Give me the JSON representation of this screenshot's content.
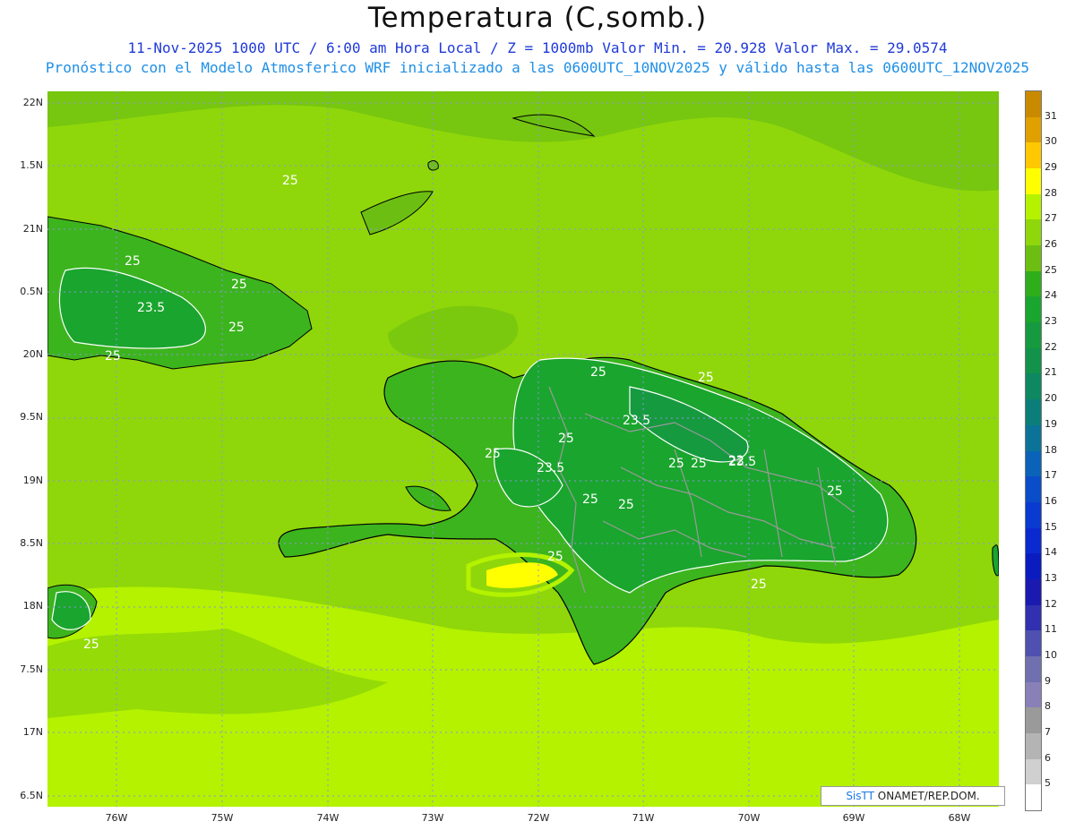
{
  "title": "Temperatura (C,somb.)",
  "subtitle_line1": "11-Nov-2025  1000 UTC / 6:00 am Hora Local / Z = 1000mb    Valor Min. = 20.928  Valor Max. = 29.0574",
  "subtitle_line2": "Pronóstico con el Modelo Atmosferico WRF inicializado a las 0600UTC_10NOV2025 y válido hasta las  0600UTC_12NOV2025",
  "colors": {
    "title": "#111111",
    "subtitle1": "#1f3ad8",
    "subtitle2": "#1f8fe6",
    "ocean_main": "#8fd70a",
    "ocean_light": "#b4f200",
    "land_dark": "#1aa52e",
    "land_mid": "#3cb41e",
    "contour": "#ffffff",
    "border": "#9a9a9a",
    "coast": "#000000"
  },
  "y_axis": {
    "labels": [
      "22N",
      "1.5N",
      "21N",
      "0.5N",
      "20N",
      "9.5N",
      "19N",
      "8.5N",
      "18N",
      "7.5N",
      "17N",
      "6.5N"
    ]
  },
  "x_axis": {
    "labels": [
      "76W",
      "75W",
      "74W",
      "73W",
      "72W",
      "71W",
      "70W",
      "69W",
      "68W"
    ]
  },
  "contour_labels": [
    "25",
    "25",
    "25",
    "23.5",
    "25",
    "25",
    "25",
    "25",
    "23.5",
    "25",
    "25",
    "25",
    "23.5",
    "25",
    "25",
    "22",
    "23.5",
    "25",
    "25",
    "25",
    "25"
  ],
  "credit": {
    "brand": "SisTT",
    "text": " ONAMET/REP.DOM."
  },
  "colorbar": {
    "labels": [
      "31",
      "30",
      "29",
      "28",
      "27",
      "26",
      "25",
      "24",
      "23",
      "22",
      "21",
      "20",
      "19",
      "18",
      "17",
      "16",
      "15",
      "14",
      "13",
      "12",
      "11",
      "10",
      "9",
      "8",
      "7",
      "6",
      "5"
    ],
    "colors": [
      "#c98a00",
      "#e0a000",
      "#ffc800",
      "#ffff00",
      "#b4f200",
      "#8fd70a",
      "#6cbf12",
      "#2fae1c",
      "#1aa52e",
      "#169a3f",
      "#12924a",
      "#0e8860",
      "#0c7e7a",
      "#0b7398",
      "#0a63b8",
      "#0a4dc8",
      "#0a3bd0",
      "#0a2ad0",
      "#0a1cc0",
      "#1a1ab0",
      "#3030b0",
      "#5050b0",
      "#7070b0",
      "#8a80b8",
      "#9a9a9a",
      "#b4b4b4",
      "#d0d0d0",
      "#ffffff"
    ]
  }
}
